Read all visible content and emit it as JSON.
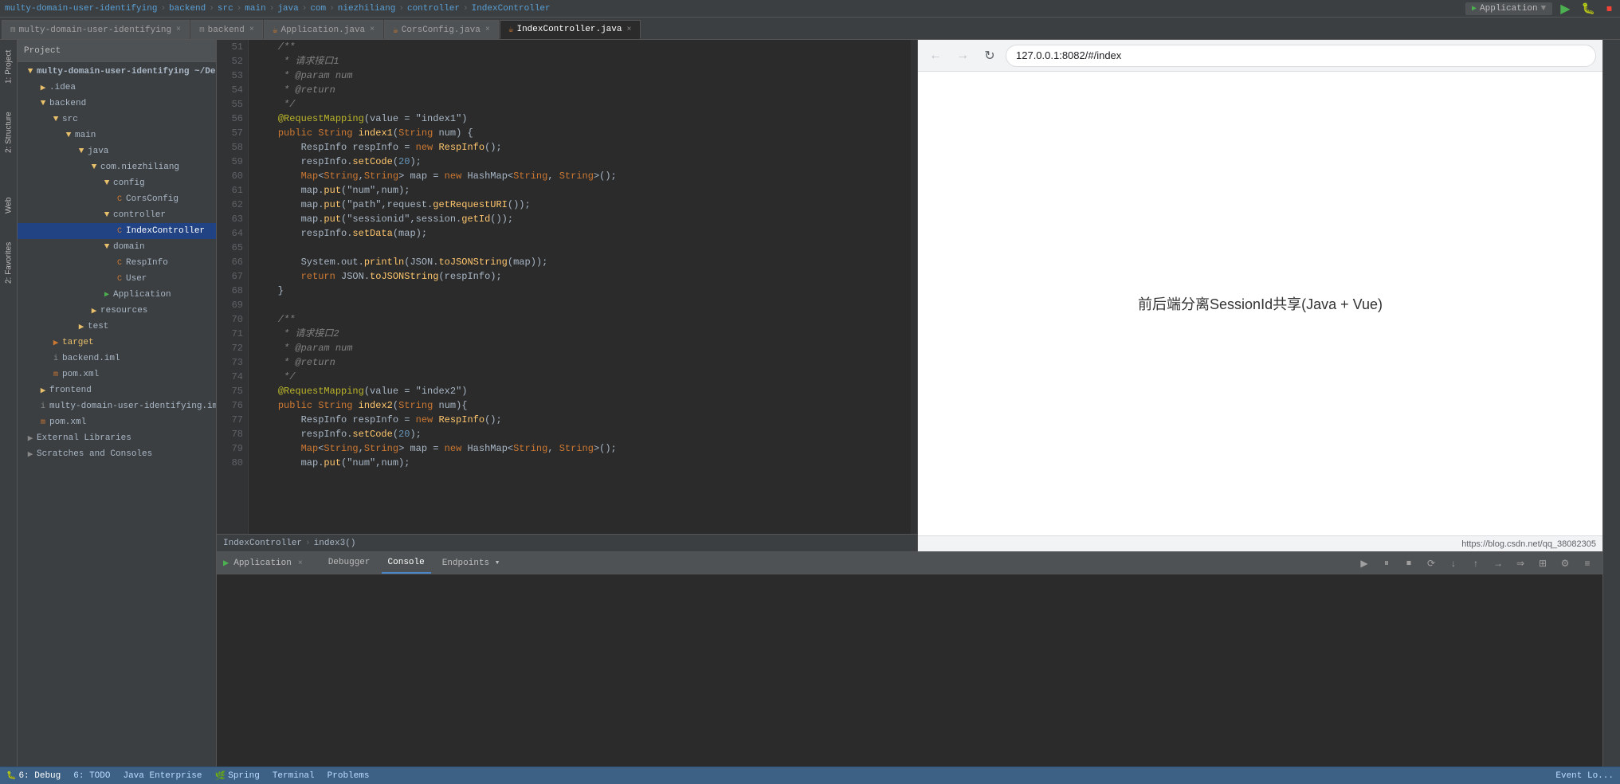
{
  "topbar": {
    "project_title": "multy-domain-user-identifying",
    "backend_label": "backend",
    "src_label": "src",
    "main_label": "main",
    "java_label": "java",
    "com_label": "com",
    "niezhiliang_label": "niezhiliang",
    "controller_label": "controller",
    "indexcontroller_label": "IndexController",
    "run_config": "Application"
  },
  "tabs": [
    {
      "id": "multy-tab",
      "label": "multy-domain-user-identifying",
      "closable": true,
      "active": false
    },
    {
      "id": "backend-tab",
      "label": "backend",
      "closable": true,
      "active": false
    },
    {
      "id": "application-tab",
      "label": "Application.java",
      "closable": true,
      "active": false
    },
    {
      "id": "corsconfig-tab",
      "label": "CorsConfig.java",
      "closable": true,
      "active": false
    },
    {
      "id": "indexcontroller-tab",
      "label": "IndexController.java",
      "closable": true,
      "active": true
    }
  ],
  "sidebar": {
    "project_label": "Project",
    "items": [
      {
        "id": "root",
        "label": "multy-domain-user-identifying ~/Desktop",
        "indent": 0,
        "type": "root",
        "expanded": true
      },
      {
        "id": "idea",
        "label": ".idea",
        "indent": 1,
        "type": "folder",
        "expanded": false
      },
      {
        "id": "backend",
        "label": "backend",
        "indent": 1,
        "type": "folder",
        "expanded": true
      },
      {
        "id": "src",
        "label": "src",
        "indent": 2,
        "type": "folder",
        "expanded": true
      },
      {
        "id": "main",
        "label": "main",
        "indent": 3,
        "type": "folder",
        "expanded": true
      },
      {
        "id": "java",
        "label": "java",
        "indent": 4,
        "type": "folder",
        "expanded": true
      },
      {
        "id": "com.niezhiliang",
        "label": "com.niezhiliang",
        "indent": 5,
        "type": "folder",
        "expanded": true
      },
      {
        "id": "config",
        "label": "config",
        "indent": 6,
        "type": "folder",
        "expanded": true
      },
      {
        "id": "CorsConfig",
        "label": "CorsConfig",
        "indent": 7,
        "type": "java",
        "expanded": false
      },
      {
        "id": "controller",
        "label": "controller",
        "indent": 6,
        "type": "folder",
        "expanded": true
      },
      {
        "id": "IndexController",
        "label": "IndexController",
        "indent": 7,
        "type": "java",
        "expanded": false
      },
      {
        "id": "domain",
        "label": "domain",
        "indent": 6,
        "type": "folder",
        "expanded": true
      },
      {
        "id": "RespInfo",
        "label": "RespInfo",
        "indent": 7,
        "type": "java",
        "expanded": false
      },
      {
        "id": "User",
        "label": "User",
        "indent": 7,
        "type": "java",
        "expanded": false
      },
      {
        "id": "Application",
        "label": "Application",
        "indent": 6,
        "type": "java-main",
        "expanded": false
      },
      {
        "id": "resources",
        "label": "resources",
        "indent": 5,
        "type": "folder",
        "expanded": false
      },
      {
        "id": "test",
        "label": "test",
        "indent": 4,
        "type": "folder",
        "expanded": false
      },
      {
        "id": "target",
        "label": "target",
        "indent": 2,
        "type": "folder-target",
        "expanded": false
      },
      {
        "id": "backend.iml",
        "label": "backend.iml",
        "indent": 2,
        "type": "iml",
        "expanded": false
      },
      {
        "id": "pom.xml-back",
        "label": "pom.xml",
        "indent": 2,
        "type": "xml",
        "expanded": false
      },
      {
        "id": "frontend",
        "label": "frontend",
        "indent": 1,
        "type": "folder",
        "expanded": false
      },
      {
        "id": "multy-iml",
        "label": "multy-domain-user-identifying.iml",
        "indent": 1,
        "type": "iml",
        "expanded": false
      },
      {
        "id": "pom.xml",
        "label": "pom.xml",
        "indent": 1,
        "type": "xml",
        "expanded": false
      },
      {
        "id": "external-libs",
        "label": "External Libraries",
        "indent": 0,
        "type": "libs",
        "expanded": false
      },
      {
        "id": "scratches",
        "label": "Scratches and Consoles",
        "indent": 0,
        "type": "scratches",
        "expanded": false
      }
    ]
  },
  "editor": {
    "filename": "IndexController.java",
    "lines": [
      {
        "num": 51,
        "code": "    /**"
      },
      {
        "num": 52,
        "code": "     * 请求接口1"
      },
      {
        "num": 53,
        "code": "     * @param num"
      },
      {
        "num": 54,
        "code": "     * @return"
      },
      {
        "num": 55,
        "code": "     */"
      },
      {
        "num": 56,
        "code": "    @RequestMapping(value = \"index1\")"
      },
      {
        "num": 57,
        "code": "    public String index1(String num) {"
      },
      {
        "num": 58,
        "code": "        RespInfo respInfo = new RespInfo();"
      },
      {
        "num": 59,
        "code": "        respInfo.setCode(20);"
      },
      {
        "num": 60,
        "code": "        Map<String,String> map = new HashMap<String, String>();"
      },
      {
        "num": 61,
        "code": "        map.put(\"num\",num);"
      },
      {
        "num": 62,
        "code": "        map.put(\"path\",request.getRequestURI());"
      },
      {
        "num": 63,
        "code": "        map.put(\"sessionid\",session.getId());"
      },
      {
        "num": 64,
        "code": "        respInfo.setData(map);"
      },
      {
        "num": 65,
        "code": ""
      },
      {
        "num": 66,
        "code": "        System.out.println(JSON.toJSONString(map));"
      },
      {
        "num": 67,
        "code": "        return JSON.toJSONString(respInfo);"
      },
      {
        "num": 68,
        "code": "    }"
      },
      {
        "num": 69,
        "code": ""
      },
      {
        "num": 70,
        "code": "    /**"
      },
      {
        "num": 71,
        "code": "     * 请求接口2"
      },
      {
        "num": 72,
        "code": "     * @param num"
      },
      {
        "num": 73,
        "code": "     * @return"
      },
      {
        "num": 74,
        "code": "     */"
      },
      {
        "num": 75,
        "code": "    @RequestMapping(value = \"index2\")"
      },
      {
        "num": 76,
        "code": "    public String index2(String num){"
      },
      {
        "num": 77,
        "code": "        RespInfo respInfo = new RespInfo();"
      },
      {
        "num": 78,
        "code": "        respInfo.setCode(20);"
      },
      {
        "num": 79,
        "code": "        Map<String,String> map = new HashMap<String, String>();"
      },
      {
        "num": 80,
        "code": "        map.put(\"num\",num);"
      }
    ]
  },
  "breadcrumb": {
    "file": "IndexController",
    "method": "index3()"
  },
  "debug": {
    "title": "Application",
    "tabs": [
      "Debugger",
      "Console",
      "Endpoints"
    ],
    "active_tab": "Console",
    "toolbar_buttons": [
      "▶",
      "⏸",
      "⏹",
      "⟳",
      "↓",
      "↑",
      "→",
      "⇒",
      "⊞",
      "≡"
    ]
  },
  "browser": {
    "url": "127.0.0.1:8082/#/index",
    "content_text": "前后端分离SessionId共享(Java + Vue)",
    "footer_text": "https://blog.csdn.net/qq_38082305"
  },
  "status_bar": {
    "debug_label": "6: Debug",
    "todo_label": "6: TODO",
    "java_enterprise_label": "Java Enterprise",
    "spring_label": "Spring",
    "terminal_label": "Terminal",
    "problems_label": "Problems",
    "event_log_label": "Event Lo..."
  }
}
